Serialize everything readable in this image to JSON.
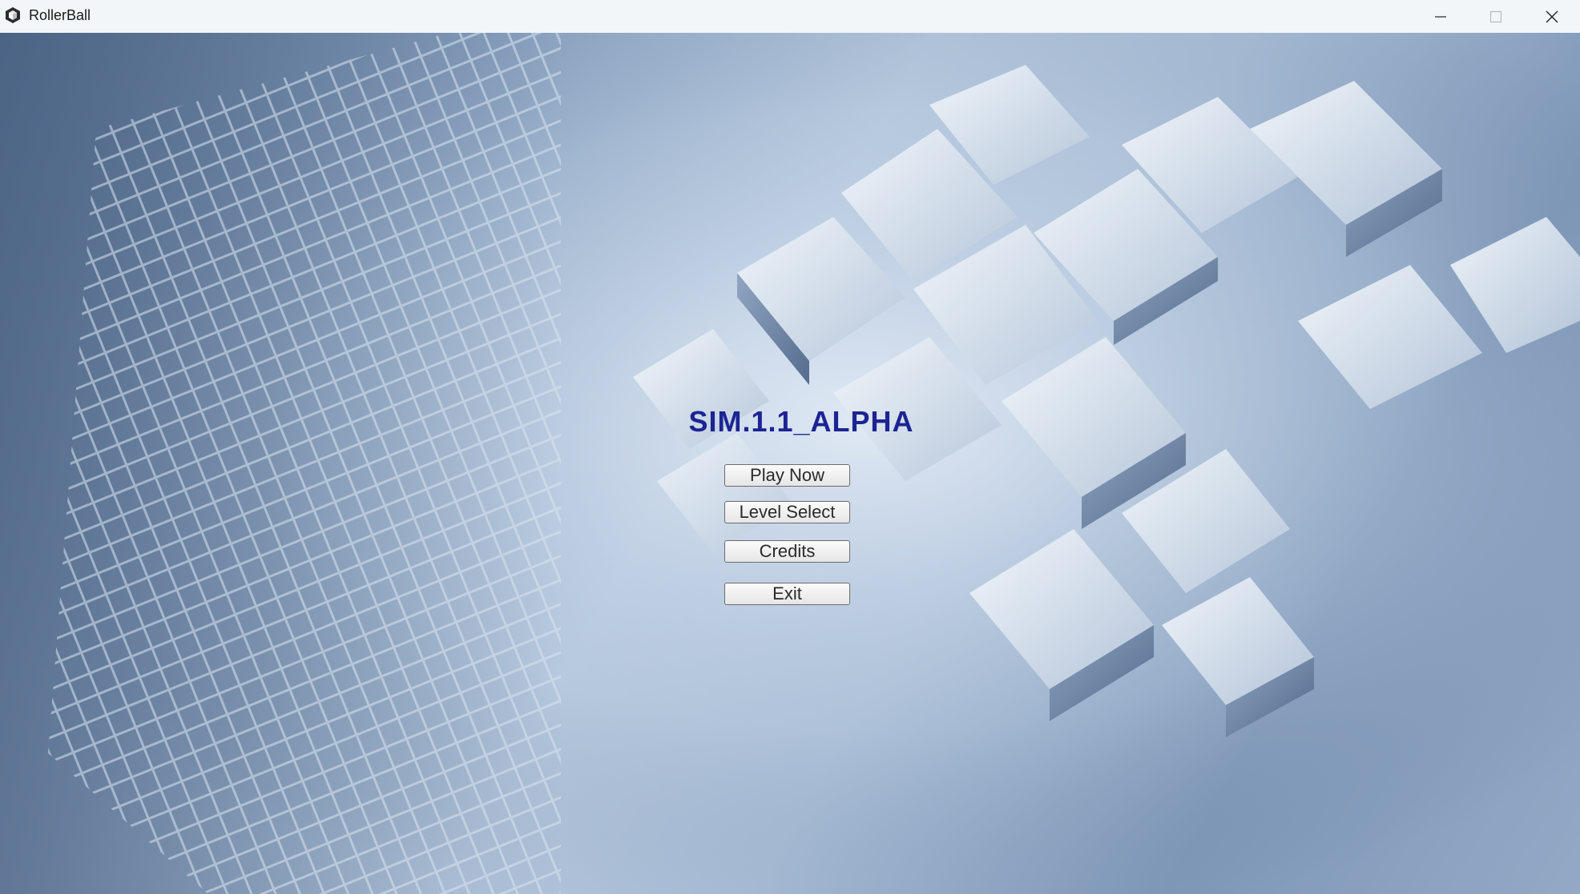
{
  "window": {
    "title": "RollerBall",
    "app_icon": "unity-cube-icon",
    "controls": {
      "minimize_icon": "minimize-icon",
      "maximize_icon": "maximize-icon",
      "close_icon": "close-icon"
    }
  },
  "menu": {
    "title": "SIM.1.1_ALPHA",
    "buttons": {
      "play_now": "Play Now",
      "level_select": "Level Select",
      "credits": "Credits",
      "exit": "Exit"
    }
  },
  "colors": {
    "title_color": "#1c2493",
    "titlebar_bg": "#f2f6f8",
    "background_tint": "#8aa2c0"
  }
}
